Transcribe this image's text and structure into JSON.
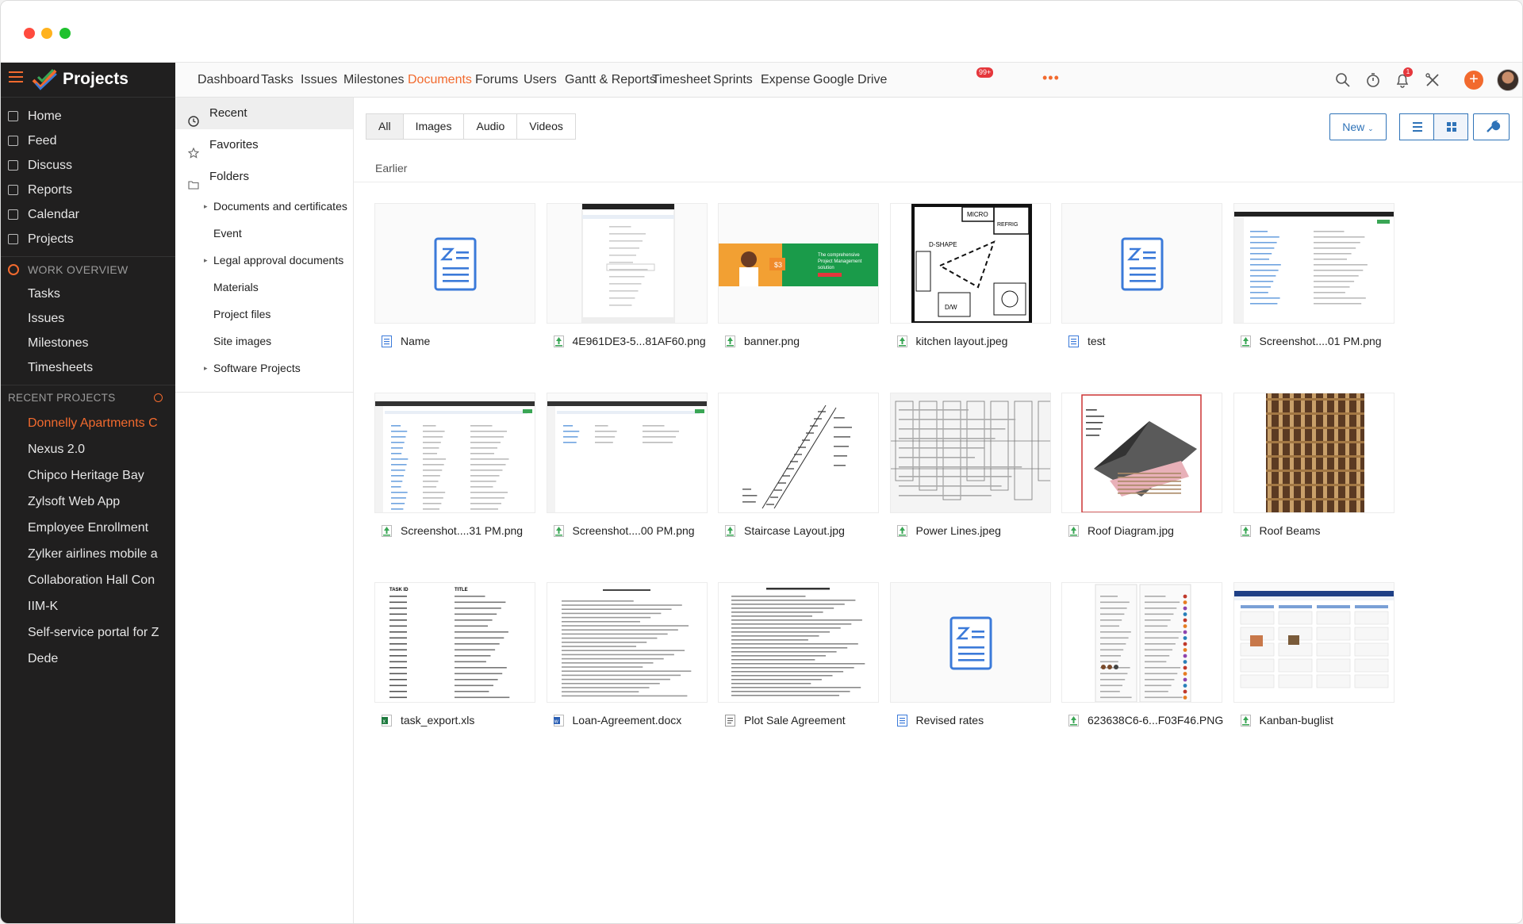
{
  "sidebar": {
    "brand": "Projects",
    "nav": [
      "Home",
      "Feed",
      "Discuss",
      "Reports",
      "Calendar",
      "Projects"
    ],
    "work_overview": {
      "label": "WORK OVERVIEW",
      "items": [
        "Tasks",
        "Issues",
        "Milestones",
        "Timesheets"
      ]
    },
    "recent_projects": {
      "label": "RECENT PROJECTS",
      "items": [
        "Donnelly Apartments C",
        "Nexus 2.0",
        "Chipco Heritage Bay",
        "Zylsoft Web App",
        "Employee Enrollment",
        "Zylker airlines mobile a",
        "Collaboration Hall Con",
        "IIM-K",
        "Self-service portal for Z",
        "Dede"
      ]
    }
  },
  "topnav": {
    "tabs": [
      "Dashboard",
      "Tasks",
      "Issues",
      "Milestones",
      "Documents",
      "Forums",
      "Users",
      "Gantt & Reports",
      "Timesheet",
      "Sprints",
      "Expense",
      "Google Drive"
    ],
    "active": "Documents",
    "timesheet_badge": "99+",
    "bell_badge": "1",
    "more": "•••",
    "plus": "+"
  },
  "folders": {
    "items": [
      "Recent",
      "Favorites",
      "Folders"
    ],
    "active": "Recent",
    "subfolders": [
      {
        "label": "Documents and certificates",
        "expandable": true
      },
      {
        "label": "Event",
        "expandable": false
      },
      {
        "label": "Legal approval documents",
        "expandable": true
      },
      {
        "label": "Materials",
        "expandable": false
      },
      {
        "label": "Project files",
        "expandable": false
      },
      {
        "label": "Site images",
        "expandable": false
      },
      {
        "label": "Software Projects",
        "expandable": true
      }
    ]
  },
  "main": {
    "filter_tabs": [
      "All",
      "Images",
      "Audio",
      "Videos"
    ],
    "active_filter": "All",
    "new_button": "New",
    "section_label": "Earlier",
    "files": [
      {
        "name": "Name",
        "kind": "doc",
        "thumb": "zdoc"
      },
      {
        "name": "4E961DE3-5...81AF60.png",
        "kind": "image",
        "thumb": "screenshot-form"
      },
      {
        "name": "banner.png",
        "kind": "image",
        "thumb": "banner"
      },
      {
        "name": "kitchen layout.jpeg",
        "kind": "image",
        "thumb": "kitchen"
      },
      {
        "name": "test",
        "kind": "doc",
        "thumb": "zdoc"
      },
      {
        "name": "Screenshot....01 PM.png",
        "kind": "image",
        "thumb": "screenshot-list"
      },
      {
        "name": "Screenshot....31 PM.png",
        "kind": "image",
        "thumb": "screenshot-table"
      },
      {
        "name": "Screenshot....00 PM.png",
        "kind": "image",
        "thumb": "screenshot-table2"
      },
      {
        "name": "Staircase Layout.jpg",
        "kind": "image",
        "thumb": "staircase"
      },
      {
        "name": "Power Lines.jpeg",
        "kind": "image",
        "thumb": "powerlines"
      },
      {
        "name": "Roof Diagram.jpg",
        "kind": "image",
        "thumb": "roof"
      },
      {
        "name": "Roof Beams",
        "kind": "image",
        "thumb": "beams"
      },
      {
        "name": "task_export.xls",
        "kind": "xls",
        "thumb": "xls"
      },
      {
        "name": "Loan-Agreement.docx",
        "kind": "word",
        "thumb": "letter"
      },
      {
        "name": "Plot Sale Agreement",
        "kind": "pdf",
        "thumb": "agreement"
      },
      {
        "name": "Revised rates",
        "kind": "doc",
        "thumb": "zdoc"
      },
      {
        "name": "623638C6-6...F03F46.PNG",
        "kind": "image",
        "thumb": "mobile"
      },
      {
        "name": "Kanban-buglist",
        "kind": "image",
        "thumb": "kanban"
      }
    ],
    "thumb_text": {
      "banner_price": "$3",
      "banner_lines": [
        "The comprehensive",
        "Project Management",
        "solution"
      ],
      "kitchen_micro": "MICRO",
      "kitchen_refrig": "REFRIG",
      "kitchen_shape": "D-SHAPE",
      "kitchen_dw": "D/W",
      "xls_col1": "TASK ID",
      "xls_col2": "TITLE"
    }
  }
}
